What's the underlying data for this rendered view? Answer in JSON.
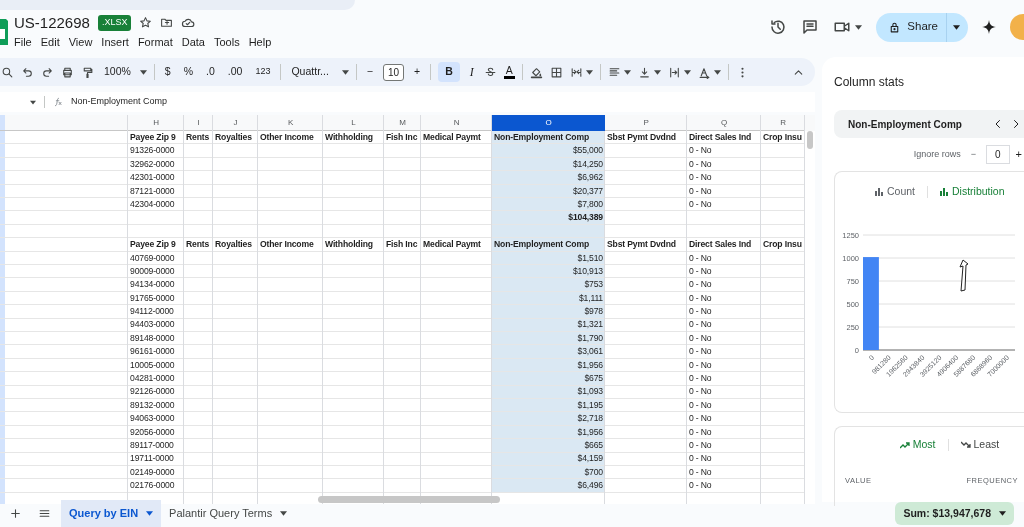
{
  "app": {
    "title": "US-122698",
    "file_type": ".XLSX"
  },
  "menu": [
    "File",
    "Edit",
    "View",
    "Insert",
    "Format",
    "Data",
    "Tools",
    "Help"
  ],
  "share": {
    "label": "Share"
  },
  "toolbar": {
    "zoom": "100%",
    "currency": "$",
    "percent": "%",
    "decrease_decimals": ".0",
    "increase_decimals": ".00",
    "number_format": "123",
    "font": "Quattr...",
    "font_minus": "−",
    "font_size": "10",
    "font_plus": "+",
    "bold": {
      "label": "B",
      "on": true
    },
    "italic": {
      "label": "I",
      "on": false
    },
    "text_color": "A"
  },
  "formula_bar": {
    "content": "Non-Employment Comp"
  },
  "grid": {
    "columns": [
      {
        "label": "H",
        "selected": false
      },
      {
        "label": "I",
        "selected": false
      },
      {
        "label": "J",
        "selected": false
      },
      {
        "label": "K",
        "selected": false
      },
      {
        "label": "L",
        "selected": false
      },
      {
        "label": "M",
        "selected": false
      },
      {
        "label": "N",
        "selected": false
      },
      {
        "label": "O",
        "selected": true
      },
      {
        "label": "P",
        "selected": false
      },
      {
        "label": "Q",
        "selected": false
      },
      {
        "label": "R",
        "selected": false
      }
    ],
    "rows": [
      {
        "kind": "header",
        "cells": [
          "Payee Zip 9",
          "Rents",
          "Royalties",
          "Other Income",
          "Withholding",
          "Fish Inc",
          "Medical Paymt",
          "Non-Employment Comp",
          "Sbst Pymt Dvdnd",
          "Direct Sales Ind",
          "Crop Insu"
        ]
      },
      {
        "kind": "data",
        "zip": "91326-0000",
        "amount": "$55,000",
        "direct_sales": "0 - No"
      },
      {
        "kind": "data",
        "zip": "32962-0000",
        "amount": "$14,250",
        "direct_sales": "0 - No"
      },
      {
        "kind": "data",
        "zip": "42301-0000",
        "amount": "$6,962",
        "direct_sales": "0 - No"
      },
      {
        "kind": "data",
        "zip": "87121-0000",
        "amount": "$20,377",
        "direct_sales": "0 - No"
      },
      {
        "kind": "data",
        "zip": "42304-0000",
        "amount": "$7,800",
        "direct_sales": "0 - No"
      },
      {
        "kind": "total",
        "amount": "$104,389"
      },
      {
        "kind": "blank"
      },
      {
        "kind": "header",
        "cells": [
          "Payee Zip 9",
          "Rents",
          "Royalties",
          "Other Income",
          "Withholding",
          "Fish Inc",
          "Medical Paymt",
          "Non-Employment Comp",
          "Sbst Pymt Dvdnd",
          "Direct Sales Ind",
          "Crop Insu"
        ]
      },
      {
        "kind": "data",
        "zip": "40769-0000",
        "amount": "$1,510",
        "direct_sales": "0 - No"
      },
      {
        "kind": "data",
        "zip": "90009-0000",
        "amount": "$10,913",
        "direct_sales": "0 - No"
      },
      {
        "kind": "data",
        "zip": "94134-0000",
        "amount": "$753",
        "direct_sales": "0 - No"
      },
      {
        "kind": "data",
        "zip": "91765-0000",
        "amount": "$1,111",
        "direct_sales": "0 - No"
      },
      {
        "kind": "data",
        "zip": "94112-0000",
        "amount": "$978",
        "direct_sales": "0 - No"
      },
      {
        "kind": "data",
        "zip": "94403-0000",
        "amount": "$1,321",
        "direct_sales": "0 - No"
      },
      {
        "kind": "data",
        "zip": "89148-0000",
        "amount": "$1,790",
        "direct_sales": "0 - No"
      },
      {
        "kind": "data",
        "zip": "96161-0000",
        "amount": "$3,061",
        "direct_sales": "0 - No"
      },
      {
        "kind": "data",
        "zip": "10005-0000",
        "amount": "$1,956",
        "direct_sales": "0 - No"
      },
      {
        "kind": "data",
        "zip": "04281-0000",
        "amount": "$675",
        "direct_sales": "0 - No"
      },
      {
        "kind": "data",
        "zip": "92126-0000",
        "amount": "$1,093",
        "direct_sales": "0 - No"
      },
      {
        "kind": "data",
        "zip": "89132-0000",
        "amount": "$1,195",
        "direct_sales": "0 - No"
      },
      {
        "kind": "data",
        "zip": "94063-0000",
        "amount": "$2,718",
        "direct_sales": "0 - No"
      },
      {
        "kind": "data",
        "zip": "92056-0000",
        "amount": "$1,956",
        "direct_sales": "0 - No"
      },
      {
        "kind": "data",
        "zip": "89117-0000",
        "amount": "$665",
        "direct_sales": "0 - No"
      },
      {
        "kind": "data",
        "zip": "19711-0000",
        "amount": "$4,159",
        "direct_sales": "0 - No"
      },
      {
        "kind": "data",
        "zip": "02149-0000",
        "amount": "$700",
        "direct_sales": "0 - No"
      },
      {
        "kind": "data",
        "zip": "02176-0000",
        "amount": "$6,496",
        "direct_sales": "0 - No"
      }
    ]
  },
  "column_stats": {
    "title": "Column stats",
    "column": "Non-Employment Comp",
    "ignore_rows_label": "Ignore rows",
    "ignore_minus": "−",
    "ignore_rows_value": "0",
    "ignore_plus": "+",
    "chart_tabs": [
      {
        "label": "Count",
        "selected": false
      },
      {
        "label": "Distribution",
        "selected": true
      }
    ],
    "chart_data": {
      "type": "bar",
      "grid": true,
      "categories": [
        "0",
        "981280",
        "1962560",
        "2943840",
        "3925120",
        "4906400",
        "5887680",
        "6868960",
        "7000000"
      ],
      "ylim": [
        0,
        1250
      ],
      "yticks": [
        0,
        250,
        500,
        750,
        1000,
        1250
      ],
      "series": [
        {
          "color": "#4285f4",
          "values": [
            1010,
            0,
            0,
            0,
            0,
            0,
            0,
            0,
            0
          ]
        }
      ]
    },
    "frequency_tabs": [
      {
        "label": "Most",
        "selected": true
      },
      {
        "label": "Least",
        "selected": false
      }
    ],
    "frequency_columns": [
      "VALUE",
      "FREQUENCY"
    ]
  },
  "sheet_tabs": [
    {
      "label": "Query by EIN",
      "selected": true
    },
    {
      "label": "Palantir Query Terms",
      "selected": false
    }
  ],
  "status": {
    "sum": "Sum: $13,947,678"
  }
}
